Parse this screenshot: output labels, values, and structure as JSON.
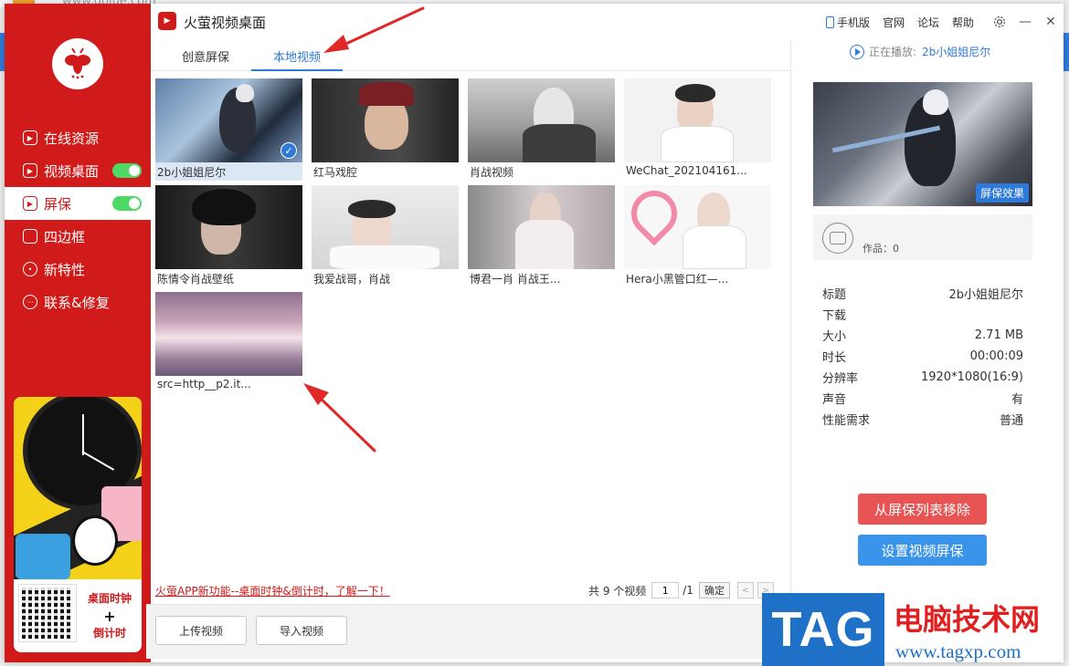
{
  "background": {
    "url_text": "www.golue.com"
  },
  "window": {
    "title": "火萤视频桌面"
  },
  "titlebar": {
    "links": [
      "手机版",
      "官网",
      "论坛",
      "帮助"
    ],
    "settings_icon": "gear-icon",
    "minimize_icon": "minimize-icon",
    "close_icon": "close-icon"
  },
  "sidebar": {
    "items": [
      {
        "label": "在线资源",
        "toggle": false
      },
      {
        "label": "视频桌面",
        "toggle": true
      },
      {
        "label": "屏保",
        "toggle": true,
        "active": true
      },
      {
        "label": "四边框",
        "toggle": false
      },
      {
        "label": "新特性",
        "toggle": false
      },
      {
        "label": "联系&修复",
        "toggle": false
      }
    ],
    "promo_line1": "桌面时钟",
    "promo_plus": "+",
    "promo_line2": "倒计时"
  },
  "tabs": [
    {
      "label": "创意屏保",
      "active": false
    },
    {
      "label": "本地视频",
      "active": true
    }
  ],
  "videos": [
    {
      "caption": "2b小姐姐尼尔",
      "selected": true
    },
    {
      "caption": "红马戏腔",
      "selected": false
    },
    {
      "caption": "肖战视频",
      "selected": false
    },
    {
      "caption": "WeChat_202104161...",
      "selected": false
    },
    {
      "caption": "陈情令肖战壁纸",
      "selected": false
    },
    {
      "caption": "我爱战哥，肖战",
      "selected": false
    },
    {
      "caption": "博君一肖 肖战王...",
      "selected": false
    },
    {
      "caption": "Hera小黑管口红—...",
      "selected": false
    },
    {
      "caption": "src=http__p2.it...",
      "selected": false
    }
  ],
  "footer": {
    "promo_link": "火萤APP新功能--桌面时钟&倒计时，了解一下！",
    "total_prefix": "共 9 个视频",
    "page_value": "1",
    "page_total": "/1",
    "confirm": "确定",
    "upload_button": "上传视频",
    "import_button": "导入视频"
  },
  "right_panel": {
    "now_playing_label": "正在播放:",
    "now_playing_title": "2b小姐姐尼尔",
    "preview_badge": "屏保效果",
    "works": "作品：0",
    "props": [
      {
        "key": "标题",
        "value": "2b小姐姐尼尔"
      },
      {
        "key": "下载",
        "value": ""
      },
      {
        "key": "大小",
        "value": "2.71 MB"
      },
      {
        "key": "时长",
        "value": "00:00:09"
      },
      {
        "key": "分辨率",
        "value": "1920*1080(16:9)"
      },
      {
        "key": "声音",
        "value": "有"
      },
      {
        "key": "性能需求",
        "value": "普通"
      }
    ],
    "remove_button": "从屏保列表移除",
    "set_button": "设置视频屏保"
  },
  "watermark": {
    "tag": "TAG",
    "cn": "电脑技术网",
    "url": "www.tagxp.com"
  },
  "colors": {
    "brand_red": "#d11a1a",
    "accent_blue": "#2f7ad8",
    "toggle_green": "#4cd964",
    "danger_button": "#e85454",
    "primary_button": "#3a95ea"
  }
}
